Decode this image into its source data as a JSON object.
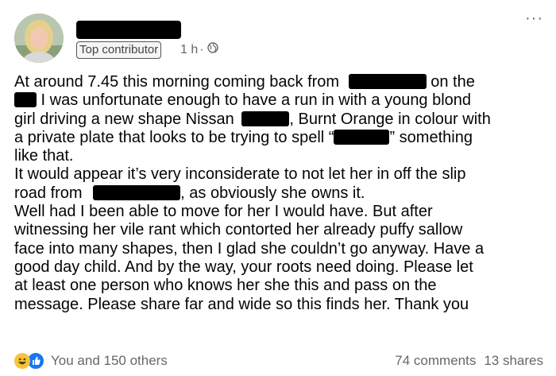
{
  "header": {
    "badge": "Top contributor",
    "time": "1 h",
    "separator": "·",
    "more_label": "···"
  },
  "post": {
    "lines": [
      [
        "At around 7.45 this morning coming back from",
        " on the"
      ],
      [
        "",
        " I was unfortunate enough to have a run in with a young blond"
      ],
      [
        "girl driving a new shape Nissan",
        ", Burnt Orange in colour with"
      ],
      [
        "a private plate that looks to be trying to spell “",
        "” something"
      ],
      [
        "like that."
      ],
      [
        "It would appear it’s very inconsiderate to not let her in off the slip"
      ],
      [
        "road from",
        ", as obviously she owns it."
      ],
      [
        "Well had I been able to move for her I would have. But after"
      ],
      [
        "witnessing her vile rant which contorted her already puffy sallow"
      ],
      [
        "face into many shapes, then I glad she couldn’t go anyway. Have a"
      ],
      [
        "good day child. And by the way, your roots need doing. Please let"
      ],
      [
        "at least one person who knows her she this and pass on the"
      ],
      [
        "message. Please share far and wide so this finds her. Thank you"
      ]
    ]
  },
  "footer": {
    "reactions_text": "You and 150 others",
    "comments": "74 comments",
    "shares": "13 shares"
  },
  "colors": {
    "text": "#050505",
    "secondary": "#65676b",
    "like_blue": "#1877f2",
    "haha_yellow": "#f7c33c"
  }
}
